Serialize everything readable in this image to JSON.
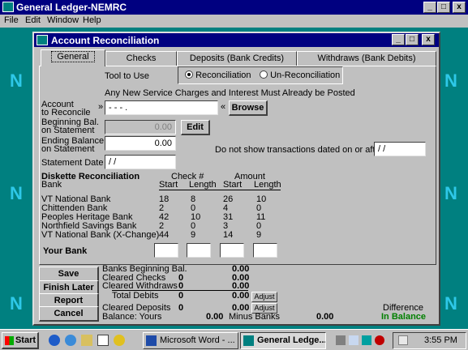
{
  "app": {
    "title": "General Ledger-NEMRC",
    "menu": [
      "File",
      "Edit",
      "Window",
      "Help"
    ],
    "win_buttons": [
      "_",
      "□",
      "x"
    ]
  },
  "child": {
    "title": "Account Reconciliation",
    "tabs": [
      "General",
      "Checks",
      "Deposits (Bank Credits)",
      "Withdraws (Bank Debits)"
    ],
    "active_tab": "General"
  },
  "general": {
    "tool_label": "Tool to Use",
    "radio_reconciliation": "Reconciliation",
    "radio_unreconciliation": "Un-Reconciliation",
    "selected_tool": "Reconciliation",
    "notice": "Any New Service Charges and Interest Must Already be Posted",
    "account_label_1": "Account",
    "account_label_2": "to Reconcile",
    "account_marker_left": "»",
    "account_value": "- - - .",
    "account_marker_right": "«",
    "browse_label": "Browse",
    "beg_bal_label_1": "Beginning Bal.",
    "beg_bal_label_2": "on Statement",
    "beg_bal_value": "0.00",
    "edit_label": "Edit",
    "end_bal_label_1": "Ending Balance",
    "end_bal_label_2": "on Statement",
    "end_bal_value": "0.00",
    "statement_date_label": "Statement Date",
    "statement_date_value": "/ /",
    "no_show_label": "Do not show transactions dated on or after:",
    "no_show_value": "/ /"
  },
  "diskette": {
    "title": "Diskette Reconciliation",
    "bank_header": "Bank",
    "check_header": "Check #",
    "amount_header": "Amount",
    "start_header": "Start",
    "length_header": "Length",
    "banks": [
      {
        "name": "VT National Bank",
        "check_start": "18",
        "check_len": "8",
        "amt_start": "26",
        "amt_len": "10"
      },
      {
        "name": "Chittenden Bank",
        "check_start": "2",
        "check_len": "0",
        "amt_start": "4",
        "amt_len": "0"
      },
      {
        "name": "Peoples Heritage Bank",
        "check_start": "42",
        "check_len": "10",
        "amt_start": "31",
        "amt_len": "11"
      },
      {
        "name": "Northfield Savings Bank",
        "check_start": "2",
        "check_len": "0",
        "amt_start": "3",
        "amt_len": "0"
      },
      {
        "name": "VT National Bank (X-Change)",
        "check_start": "44",
        "check_len": "9",
        "amt_start": "14",
        "amt_len": "9"
      }
    ],
    "your_bank_label": "Your Bank"
  },
  "actions": {
    "save": "Save",
    "finish_later": "Finish Later",
    "report": "Report",
    "cancel": "Cancel"
  },
  "balance": {
    "banks_beg_label": "Banks Beginning Bal.",
    "banks_beg_value": "0.00",
    "cleared_checks_label": "Cleared Checks",
    "cleared_checks_count": "0",
    "cleared_checks_value": "0.00",
    "cleared_withdraws_label": "Cleared Withdraws",
    "cleared_withdraws_count": "0",
    "cleared_withdraws_value": "0.00",
    "total_debits_label": "Total Debits",
    "total_debits_count": "0",
    "total_debits_value": "0.00",
    "adjust_label": "Adjust",
    "cleared_deposits_label": "Cleared Deposits",
    "cleared_deposits_count": "0",
    "cleared_deposits_value": "0.00",
    "balance_yours_label": "Balance: Yours",
    "balance_yours_value": "0.00",
    "minus_banks_label": "Minus Banks",
    "minus_banks_value": "0.00",
    "difference_label": "Difference",
    "in_balance_label": "In Balance",
    "in_balance_color": "#008000"
  },
  "taskbar": {
    "start": "Start",
    "tasks": [
      "Microsoft Word - ...",
      "General Ledge..."
    ],
    "clock": "3:55 PM"
  }
}
